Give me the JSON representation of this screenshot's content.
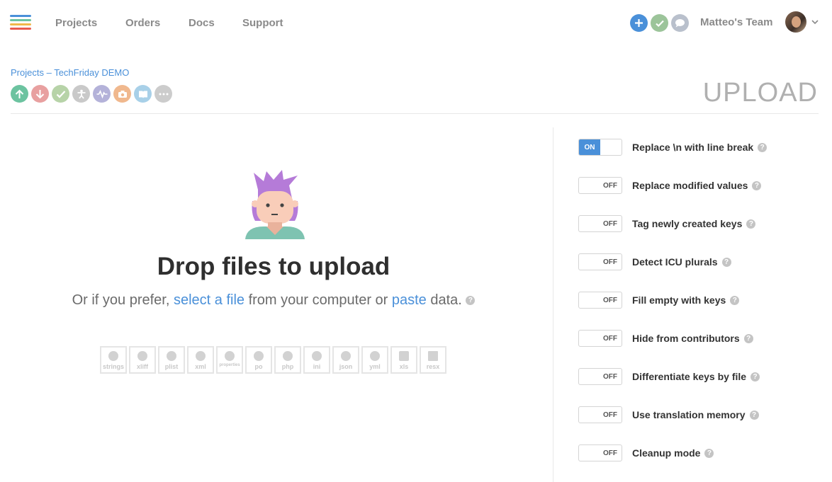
{
  "nav": {
    "links": [
      "Projects",
      "Orders",
      "Docs",
      "Support"
    ],
    "team_name": "Matteo's Team"
  },
  "breadcrumb": {
    "root": "Projects",
    "separator": " – ",
    "project": "TechFriday DEMO"
  },
  "page_title": "UPLOAD",
  "toolbar_icons": [
    {
      "icon": "upload-icon",
      "color": "#6cc3a0"
    },
    {
      "icon": "download-icon",
      "color": "#e8a0a0"
    },
    {
      "icon": "review-check-icon",
      "color": "#b7d3a8"
    },
    {
      "icon": "contributors-icon",
      "color": "#c9c9c9"
    },
    {
      "icon": "activity-icon",
      "color": "#b4b2d9"
    },
    {
      "icon": "screenshots-icon",
      "color": "#f0b88e"
    },
    {
      "icon": "glossary-icon",
      "color": "#a8d0e8"
    },
    {
      "icon": "more-icon",
      "color": "#cccccc"
    }
  ],
  "upload": {
    "title": "Drop files to upload",
    "sub_before": "Or if you prefer, ",
    "select_link": "select a file",
    "sub_middle": " from your computer or ",
    "paste_link": "paste",
    "sub_after": " data.",
    "help": "?"
  },
  "formats": [
    "strings",
    "xliff",
    "plist",
    "xml",
    "properties",
    "po",
    "php",
    "ini",
    "json",
    "yml",
    "xls",
    "resx"
  ],
  "options": [
    {
      "label": "Replace \\n with line break",
      "state": "ON"
    },
    {
      "label": "Replace modified values",
      "state": "OFF"
    },
    {
      "label": "Tag newly created keys",
      "state": "OFF"
    },
    {
      "label": "Detect ICU plurals",
      "state": "OFF"
    },
    {
      "label": "Fill empty with keys",
      "state": "OFF"
    },
    {
      "label": "Hide from contributors",
      "state": "OFF"
    },
    {
      "label": "Differentiate keys by file",
      "state": "OFF"
    },
    {
      "label": "Use translation memory",
      "state": "OFF"
    },
    {
      "label": "Cleanup mode",
      "state": "OFF"
    }
  ],
  "colors": {
    "link": "#4a90d9",
    "toggle_on": "#4a90d9",
    "add_button": "#4a90d9",
    "check_button": "#9cc49a",
    "chat_button": "#b9c0cc"
  }
}
